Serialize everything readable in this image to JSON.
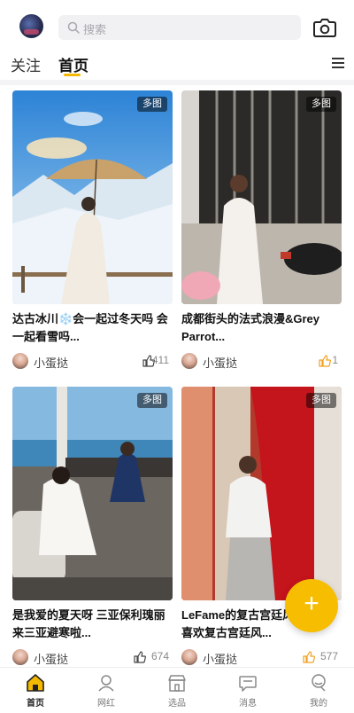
{
  "search": {
    "placeholder": "搜索"
  },
  "tabs": [
    {
      "label": "关注"
    },
    {
      "label": "首页"
    }
  ],
  "feed": [
    {
      "badge": "多图",
      "caption": "达古冰川❄️会一起过冬天吗 会一起看雪吗...",
      "author": "小蛋挞",
      "likes": "411"
    },
    {
      "badge": "多图",
      "caption": "成都街头的法式浪漫&Grey Parrot...",
      "author": "小蛋挞",
      "likes": "1"
    },
    {
      "badge": "多图",
      "caption": "是我爱的夏天呀 三亚保利瑰丽来三亚避寒啦...",
      "author": "小蛋挞",
      "likes": "674"
    },
    {
      "badge": "多图",
      "caption": "LeFame的复古宫廷风 一直很喜欢复古宫廷风...",
      "author": "小蛋挞",
      "likes": "577"
    }
  ],
  "fab": {
    "symbol": "+"
  },
  "bottom_nav": [
    {
      "label": "首页",
      "icon": "home-icon"
    },
    {
      "label": "网红",
      "icon": "influencer-icon"
    },
    {
      "label": "选品",
      "icon": "shop-icon"
    },
    {
      "label": "消息",
      "icon": "message-icon"
    },
    {
      "label": "我的",
      "icon": "profile-icon"
    }
  ],
  "colors": {
    "accent": "#f5b800",
    "like_active": "#f0a020",
    "like_inactive": "#444444"
  }
}
